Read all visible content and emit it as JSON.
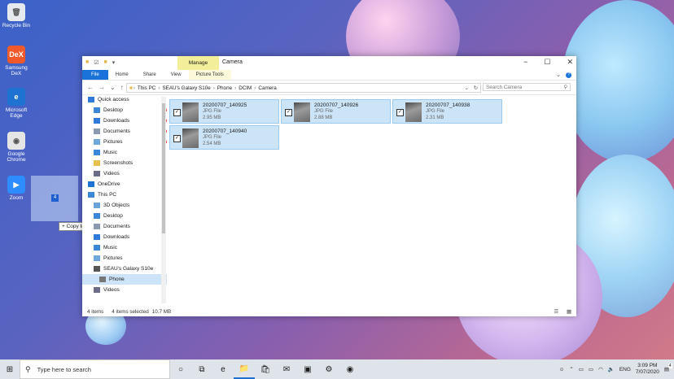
{
  "desktop": {
    "icons": [
      {
        "label": "Recycle Bin",
        "glyph": "🗑",
        "color": "#e6e9ee",
        "icon": "recycle-bin-icon"
      },
      {
        "label": "Samsung\nDeX",
        "glyph": "DeX",
        "color": "#f2592a",
        "icon": "samsung-dex-icon"
      },
      {
        "label": "Microsoft\nEdge",
        "glyph": "e",
        "color": "#1e73d2",
        "icon": "edge-icon"
      },
      {
        "label": "Google\nChrome",
        "glyph": "◉",
        "color": "#e5e5e5",
        "icon": "chrome-icon"
      },
      {
        "label": "Zoom",
        "glyph": "▶",
        "color": "#2d8cff",
        "icon": "zoom-icon"
      }
    ],
    "drag_count": "4",
    "copy_tooltip": "Copy to Desktop",
    "copy_tooltip_symbol": "+"
  },
  "window": {
    "title": "Camera",
    "manage_label": "Manage",
    "ribbon_tabs": [
      "File",
      "Home",
      "Share",
      "View",
      "Picture Tools"
    ],
    "address": [
      "This PC",
      "SEAU's Galaxy S10e",
      "Phone",
      "DCIM",
      "Camera"
    ],
    "search_placeholder": "Search Camera",
    "nav_items": [
      {
        "label": "Quick access",
        "icon": "star-icon",
        "color": "#2f7ad8",
        "pinned": false,
        "selected": false,
        "indent": 1
      },
      {
        "label": "Desktop",
        "icon": "desktop-folder-icon",
        "color": "#3b87d9",
        "pinned": true,
        "selected": false,
        "indent": 2
      },
      {
        "label": "Downloads",
        "icon": "download-icon",
        "color": "#2f7ad8",
        "pinned": true,
        "selected": false,
        "indent": 2
      },
      {
        "label": "Documents",
        "icon": "documents-icon",
        "color": "#8a9bb0",
        "pinned": true,
        "selected": false,
        "indent": 2
      },
      {
        "label": "Pictures",
        "icon": "pictures-icon",
        "color": "#6ea8dc",
        "pinned": true,
        "selected": false,
        "indent": 2
      },
      {
        "label": "Music",
        "icon": "music-icon",
        "color": "#3b87d9",
        "pinned": false,
        "selected": false,
        "indent": 2
      },
      {
        "label": "Screenshots",
        "icon": "folder-icon",
        "color": "#e8c14b",
        "pinned": false,
        "selected": false,
        "indent": 2
      },
      {
        "label": "Videos",
        "icon": "videos-icon",
        "color": "#6b6b8a",
        "pinned": false,
        "selected": false,
        "indent": 2
      },
      {
        "label": "OneDrive",
        "icon": "onedrive-icon",
        "color": "#1e73d2",
        "pinned": false,
        "selected": false,
        "indent": 1
      },
      {
        "label": "This PC",
        "icon": "this-pc-icon",
        "color": "#3b87d9",
        "pinned": false,
        "selected": false,
        "indent": 1
      },
      {
        "label": "3D Objects",
        "icon": "3d-objects-icon",
        "color": "#6aa3d9",
        "pinned": false,
        "selected": false,
        "indent": 2
      },
      {
        "label": "Desktop",
        "icon": "desktop-folder-icon",
        "color": "#3b87d9",
        "pinned": false,
        "selected": false,
        "indent": 2
      },
      {
        "label": "Documents",
        "icon": "documents-icon",
        "color": "#8a9bb0",
        "pinned": false,
        "selected": false,
        "indent": 2
      },
      {
        "label": "Downloads",
        "icon": "download-icon",
        "color": "#2f7ad8",
        "pinned": false,
        "selected": false,
        "indent": 2
      },
      {
        "label": "Music",
        "icon": "music-icon",
        "color": "#3b87d9",
        "pinned": false,
        "selected": false,
        "indent": 2
      },
      {
        "label": "Pictures",
        "icon": "pictures-icon",
        "color": "#6ea8dc",
        "pinned": false,
        "selected": false,
        "indent": 2
      },
      {
        "label": "SEAU's Galaxy S10e",
        "icon": "phone-device-icon",
        "color": "#555555",
        "pinned": false,
        "selected": false,
        "indent": 2
      },
      {
        "label": "Phone",
        "icon": "phone-storage-icon",
        "color": "#777777",
        "pinned": false,
        "selected": true,
        "indent": 3
      },
      {
        "label": "Videos",
        "icon": "videos-icon",
        "color": "#6b6b8a",
        "pinned": false,
        "selected": false,
        "indent": 2
      }
    ],
    "files": [
      {
        "name": "20200707_140925",
        "type": "JPG File",
        "size": "2.95 MB",
        "checked": true
      },
      {
        "name": "20200707_140926",
        "type": "JPG File",
        "size": "2.88 MB",
        "checked": true
      },
      {
        "name": "20200707_140938",
        "type": "JPG File",
        "size": "2.31 MB",
        "checked": true
      },
      {
        "name": "20200707_140940",
        "type": "JPG File",
        "size": "2.54 MB",
        "checked": true
      }
    ],
    "status": {
      "count": "4 items",
      "selected": "4 items selected",
      "size": "10.7 MB"
    }
  },
  "taskbar": {
    "search_placeholder": "Type here to search",
    "apps": [
      {
        "name": "cortana-icon",
        "glyph": "○",
        "active": false
      },
      {
        "name": "task-view-icon",
        "glyph": "⧉",
        "active": false
      },
      {
        "name": "edge-taskbar-icon",
        "glyph": "e",
        "active": false
      },
      {
        "name": "file-explorer-taskbar-icon",
        "glyph": "📁",
        "active": true
      },
      {
        "name": "store-icon",
        "glyph": "🛍",
        "active": false
      },
      {
        "name": "mail-icon",
        "glyph": "✉",
        "active": false
      },
      {
        "name": "office-icon",
        "glyph": "▣",
        "active": false
      },
      {
        "name": "settings-icon",
        "glyph": "⚙",
        "active": false
      },
      {
        "name": "chrome-taskbar-icon",
        "glyph": "◉",
        "active": false
      }
    ],
    "lang": "ENG",
    "time": "3:09 PM",
    "date": "7/07/2020",
    "notif_count": "4"
  }
}
